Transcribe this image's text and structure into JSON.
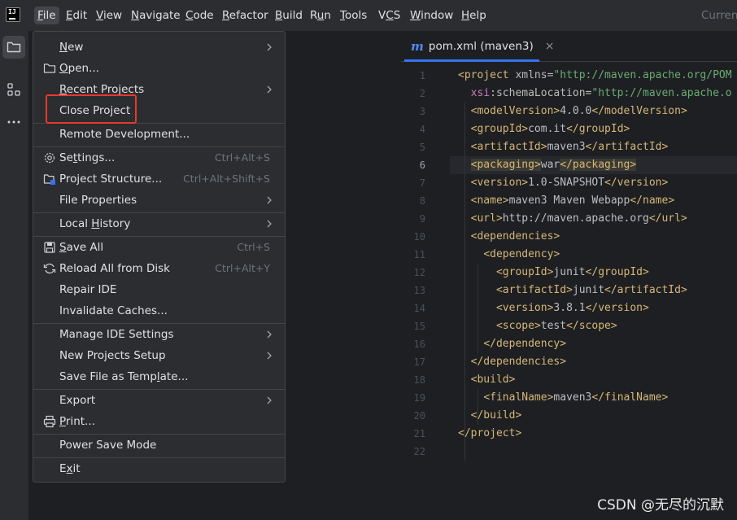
{
  "app": {
    "logo_text": "IJ"
  },
  "menubar": {
    "items": [
      {
        "label": "File",
        "active": true
      },
      {
        "label": "Edit"
      },
      {
        "label": "View"
      },
      {
        "label": "Navigate"
      },
      {
        "label": "Code"
      },
      {
        "label": "Refactor"
      },
      {
        "label": "Build"
      },
      {
        "label": "Run"
      },
      {
        "label": "Tools"
      },
      {
        "label": "VCS"
      },
      {
        "label": "Window"
      },
      {
        "label": "Help"
      }
    ],
    "current_label": "Current"
  },
  "toolstrip": {
    "items": [
      {
        "icon": "folder-icon",
        "active": true
      },
      {
        "icon": "structure-icon"
      },
      {
        "icon": "more-icon"
      }
    ]
  },
  "file_menu": {
    "items": [
      {
        "label": "New",
        "submenu": true
      },
      {
        "label": "Open...",
        "icon": "folder-icon"
      },
      {
        "label": "Recent Projects",
        "submenu": true
      },
      {
        "label": "Close Project",
        "highlighted": true
      },
      {
        "label": "Remote Development..."
      },
      {
        "label": "Settings...",
        "icon": "gear-icon",
        "shortcut": "Ctrl+Alt+S"
      },
      {
        "label": "Project Structure...",
        "icon": "project-structure-icon",
        "shortcut": "Ctrl+Alt+Shift+S"
      },
      {
        "label": "File Properties",
        "submenu": true
      },
      {
        "label": "Local History",
        "submenu": true
      },
      {
        "label": "Save All",
        "icon": "save-icon",
        "shortcut": "Ctrl+S"
      },
      {
        "label": "Reload All from Disk",
        "icon": "reload-icon",
        "shortcut": "Ctrl+Alt+Y"
      },
      {
        "label": "Repair IDE"
      },
      {
        "label": "Invalidate Caches..."
      },
      {
        "label": "Manage IDE Settings",
        "submenu": true
      },
      {
        "label": "New Projects Setup",
        "submenu": true
      },
      {
        "label": "Save File as Template..."
      },
      {
        "label": "Export",
        "submenu": true
      },
      {
        "label": "Print...",
        "icon": "print-icon"
      },
      {
        "label": "Power Save Mode"
      },
      {
        "label": "Exit"
      }
    ]
  },
  "editor": {
    "tab": {
      "icon": "maven-m-icon",
      "label": "pom.xml (maven3)",
      "close": "×"
    },
    "current_line": 6,
    "lines": [
      "<project xmlns=\"http://maven.apache.org/POM",
      "  xsi:schemaLocation=\"http://maven.apache.o",
      "  <modelVersion>4.0.0</modelVersion>",
      "  <groupId>com.it</groupId>",
      "  <artifactId>maven3</artifactId>",
      "  <packaging>war</packaging>",
      "  <version>1.0-SNAPSHOT</version>",
      "  <name>maven3 Maven Webapp</name>",
      "  <url>http://maven.apache.org</url>",
      "  <dependencies>",
      "    <dependency>",
      "      <groupId>junit</groupId>",
      "      <artifactId>junit</artifactId>",
      "      <version>3.8.1</version>",
      "      <scope>test</scope>",
      "    </dependency>",
      "  </dependencies>",
      "  <build>",
      "    <finalName>maven3</finalName>",
      "  </build>",
      "</project>",
      ""
    ]
  },
  "watermark": "CSDN @无尽的沉默",
  "colors": {
    "tag": "#d5b778",
    "string": "#6aab73",
    "namespace": "#c77dbb",
    "highlight_box": "#e53a2e",
    "accent": "#3574f0"
  }
}
